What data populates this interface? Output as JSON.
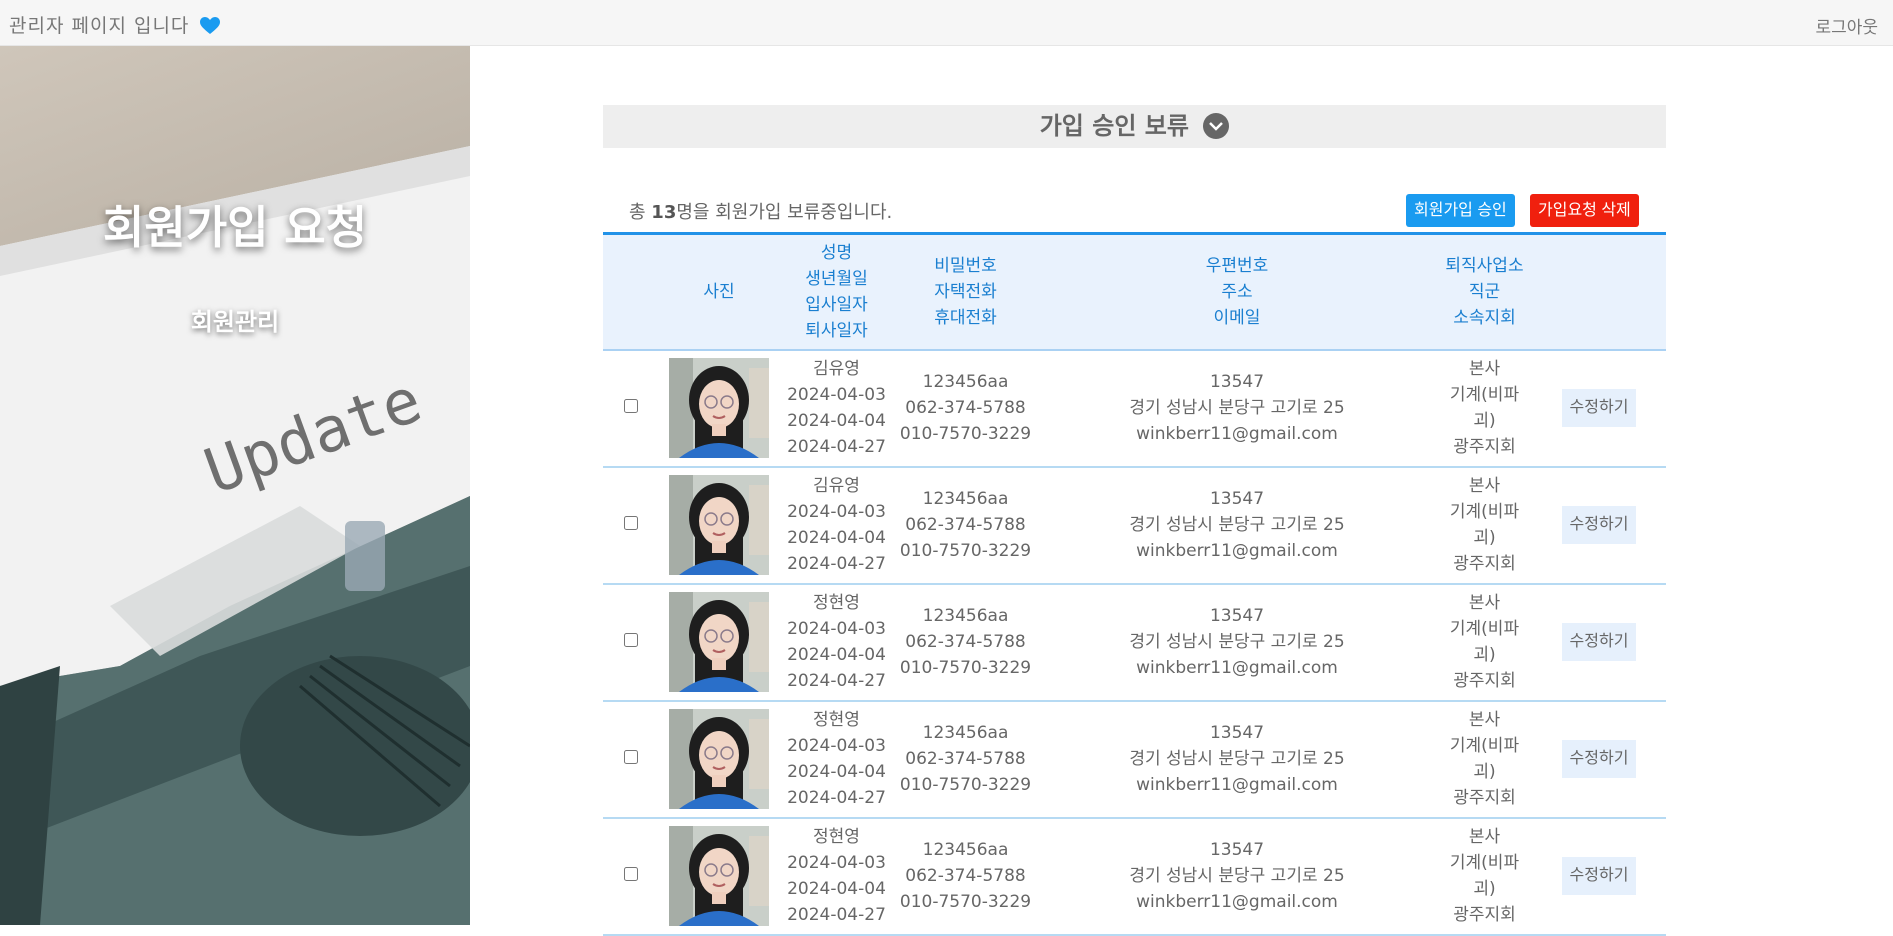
{
  "topbar": {
    "title": "관리자 페이지 입니다",
    "logout": "로그아웃"
  },
  "hero": {
    "title": "회원가입 요청",
    "subtitle": "회원관리",
    "typed_text": "Update"
  },
  "section": {
    "title": "가입 승인 보류"
  },
  "summary": {
    "prefix": "총 ",
    "count": "13",
    "suffix": "명을 회원가입 보류중입니다."
  },
  "actions": {
    "approve_label": "회원가입 승인",
    "delete_label": "가입요청 삭제"
  },
  "table": {
    "headers": {
      "photo": "사진",
      "col2": [
        "성명",
        "생년월일",
        "입사일자",
        "퇴사일자"
      ],
      "col3": [
        "비밀번호",
        "자택전화",
        "휴대전화"
      ],
      "col4": [
        "우편번호",
        "주소",
        "이메일"
      ],
      "col5": [
        "퇴직사업소",
        "직군",
        "소속지회"
      ]
    },
    "edit_label": "수정하기",
    "rows": [
      {
        "name": "김유영",
        "birth": "2024-04-03",
        "join": "2024-04-04",
        "leave": "2024-04-27",
        "password": "123456aa",
        "home_phone": "062-374-5788",
        "mobile": "010-7570-3229",
        "zip": "13547",
        "address": "경기 성남시 분당구 고기로 25",
        "email": "winkberr11@gmail.com",
        "office": "본사",
        "job_group": "기계(비파괴)",
        "branch": "광주지회"
      },
      {
        "name": "김유영",
        "birth": "2024-04-03",
        "join": "2024-04-04",
        "leave": "2024-04-27",
        "password": "123456aa",
        "home_phone": "062-374-5788",
        "mobile": "010-7570-3229",
        "zip": "13547",
        "address": "경기 성남시 분당구 고기로 25",
        "email": "winkberr11@gmail.com",
        "office": "본사",
        "job_group": "기계(비파괴)",
        "branch": "광주지회"
      },
      {
        "name": "정현영",
        "birth": "2024-04-03",
        "join": "2024-04-04",
        "leave": "2024-04-27",
        "password": "123456aa",
        "home_phone": "062-374-5788",
        "mobile": "010-7570-3229",
        "zip": "13547",
        "address": "경기 성남시 분당구 고기로 25",
        "email": "winkberr11@gmail.com",
        "office": "본사",
        "job_group": "기계(비파괴)",
        "branch": "광주지회"
      },
      {
        "name": "정현영",
        "birth": "2024-04-03",
        "join": "2024-04-04",
        "leave": "2024-04-27",
        "password": "123456aa",
        "home_phone": "062-374-5788",
        "mobile": "010-7570-3229",
        "zip": "13547",
        "address": "경기 성남시 분당구 고기로 25",
        "email": "winkberr11@gmail.com",
        "office": "본사",
        "job_group": "기계(비파괴)",
        "branch": "광주지회"
      },
      {
        "name": "정현영",
        "birth": "2024-04-03",
        "join": "2024-04-04",
        "leave": "2024-04-27",
        "password": "123456aa",
        "home_phone": "062-374-5788",
        "mobile": "010-7570-3229",
        "zip": "13547",
        "address": "경기 성남시 분당구 고기로 25",
        "email": "winkberr11@gmail.com",
        "office": "본사",
        "job_group": "기계(비파괴)",
        "branch": "광주지회"
      }
    ]
  },
  "colors": {
    "accent_blue": "#1a9bf0",
    "delete_red": "#f0200e",
    "header_text_blue": "#1a7fd0",
    "heart_blue": "#1a9bf0"
  }
}
